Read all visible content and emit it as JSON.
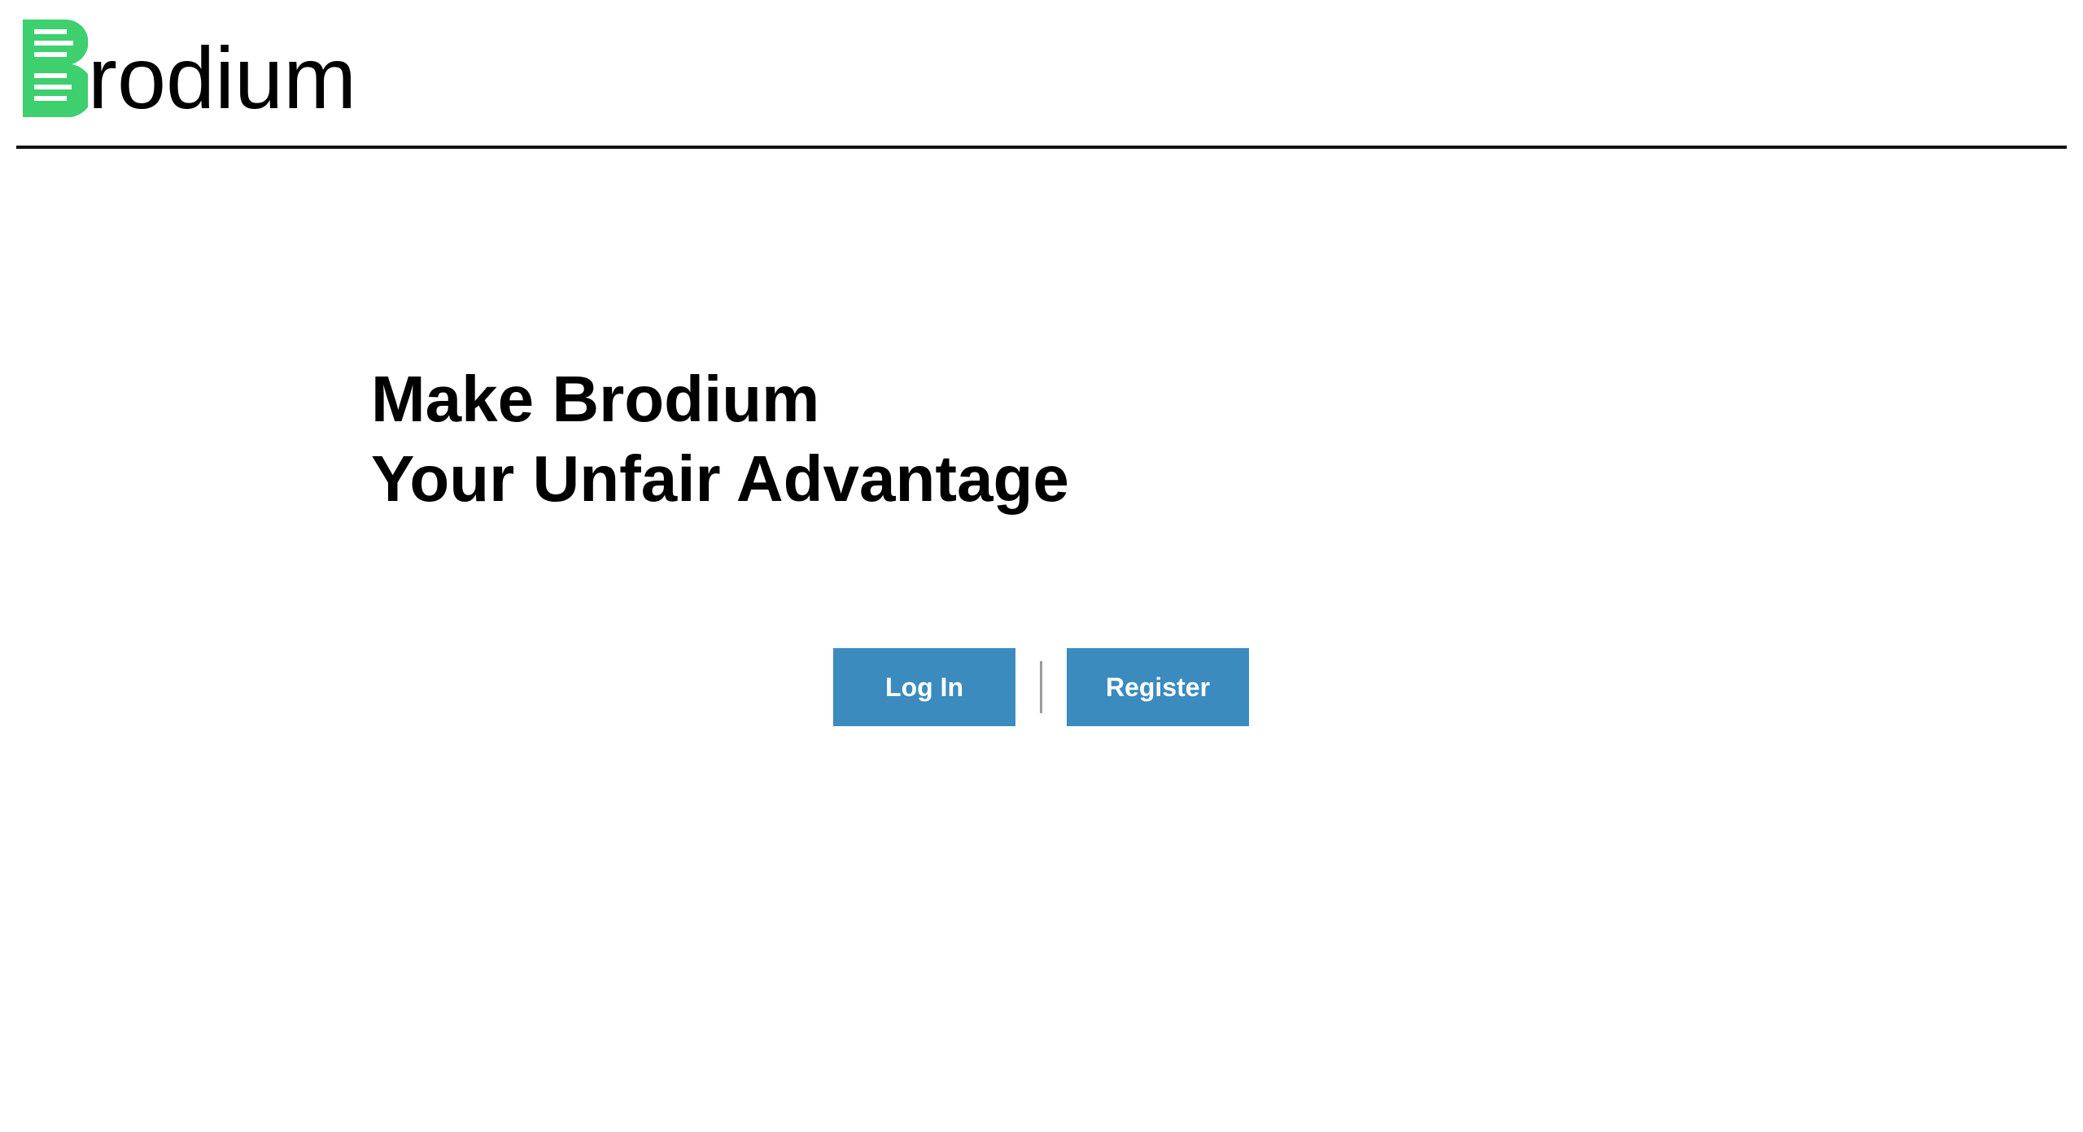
{
  "brand": {
    "name_rest": "rodium",
    "logo_icon": "brodium-b-logo-icon",
    "accent_color": "#3ecf6e"
  },
  "hero": {
    "line1": "Make Brodium",
    "line2": "Your Unfair Advantage"
  },
  "actions": {
    "login_label": "Log In",
    "register_label": "Register",
    "button_color": "#3b8bbf"
  }
}
